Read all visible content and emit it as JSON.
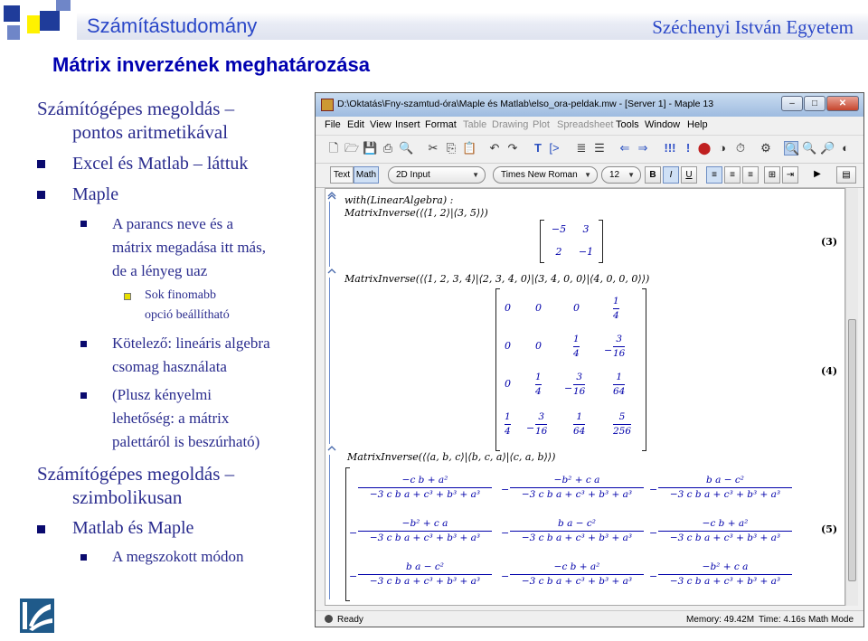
{
  "header": {
    "course": "Számítástudomány",
    "university": "Széchenyi István Egyetem",
    "title": "Mátrix inverzének meghatározása"
  },
  "bullets": [
    {
      "text": "Számítógépes megoldás –",
      "level": 0
    },
    {
      "text": "pontos aritmetikával",
      "level": 0
    },
    {
      "text": "Excel és Matlab – láttuk",
      "level": 1
    },
    {
      "text": "Maple",
      "level": 1
    },
    {
      "text": "A parancs neve és a",
      "level": 2
    },
    {
      "text": "mátrix megadása itt más,",
      "level": 2
    },
    {
      "text": "de a lényeg uaz",
      "level": 2
    },
    {
      "text": "Sok finomabb",
      "level": 3
    },
    {
      "text": "opció beállítható",
      "level": 3
    },
    {
      "text": "Kötelező: lineáris algebra",
      "level": 2
    },
    {
      "text": "csomag használata",
      "level": 2
    },
    {
      "text": "(Plusz kényelmi",
      "level": 2
    },
    {
      "text": "lehetőség: a mátrix",
      "level": 2
    },
    {
      "text": "palettáról is beszúrható)",
      "level": 2
    },
    {
      "text": "Számítógépes megoldás –",
      "level": 0
    },
    {
      "text": "szimbolikusan",
      "level": 0
    },
    {
      "text": "Matlab és Maple",
      "level": 1
    },
    {
      "text": "A megszokott módon",
      "level": 2
    }
  ],
  "maple": {
    "window_title": "D:\\Oktatás\\Fny-szamtud-óra\\Maple és Matlab\\elso_ora-peldak.mw - [Server 1] - Maple 13",
    "window_buttons": [
      "–",
      "□",
      "✕"
    ],
    "menu": [
      "File",
      "Edit",
      "View",
      "Insert",
      "Format",
      "Table",
      "Drawing",
      "Plot",
      "Spreadsheet",
      "Tools",
      "Window",
      "Help"
    ],
    "menu_disabled": [
      "Table",
      "Drawing",
      "Plot",
      "Spreadsheet"
    ],
    "format_bar": {
      "text_tab": "Text",
      "math_tab": "Math",
      "input_mode": "2D Input",
      "font": "Times New Roman",
      "size": "12",
      "bold": "B",
      "italic": "I",
      "underline": "U"
    },
    "input1_line1": "with(LinearAlgebra) :",
    "input1_line2": "MatrixInverse(⟨⟨1, 2⟩|⟨3, 5⟩⟩)",
    "output3": {
      "rows": [
        [
          "−5",
          "3"
        ],
        [
          "2",
          "−1"
        ]
      ],
      "label": "(3)"
    },
    "input2": "MatrixInverse(⟨⟨1, 2, 3, 4⟩|⟨2, 3, 4, 0⟩|⟨3, 4, 0, 0⟩|⟨4, 0, 0, 0⟩⟩)",
    "output4": {
      "label": "(4)",
      "rows": [
        [
          "0",
          "0",
          "0",
          "1/4"
        ],
        [
          "0",
          "0",
          "1/4",
          "−3/16"
        ],
        [
          "0",
          "1/4",
          "−3/16",
          "1/64"
        ],
        [
          "1/4",
          "−3/16",
          "1/64",
          "5/256"
        ]
      ]
    },
    "input3": "MatrixInverse(⟨⟨a, b, c⟩|⟨b, c, a⟩|⟨c, a, b⟩⟩)",
    "output5": {
      "label": "(5)",
      "rows": [
        [
          {
            "sign": "",
            "num": "−c b + a²"
          },
          {
            "sign": "−",
            "num": "−b² + c a"
          },
          {
            "sign": "−",
            "num": "b a − c²"
          }
        ],
        [
          {
            "sign": "−",
            "num": "−b² + c a"
          },
          {
            "sign": "−",
            "num": "b a − c²"
          },
          {
            "sign": "−",
            "num": "−c b + a²"
          }
        ],
        [
          {
            "sign": "−",
            "num": "b a − c²"
          },
          {
            "sign": "−",
            "num": "−c b + a²"
          },
          {
            "sign": "−",
            "num": "−b² + c a"
          }
        ]
      ],
      "den": "−3 c b a + c³ + b³ + a³"
    },
    "status": {
      "ready": "Ready",
      "memory": "Memory: 49.42M",
      "time": "Time: 4.16s",
      "mode": "Math Mode"
    }
  }
}
